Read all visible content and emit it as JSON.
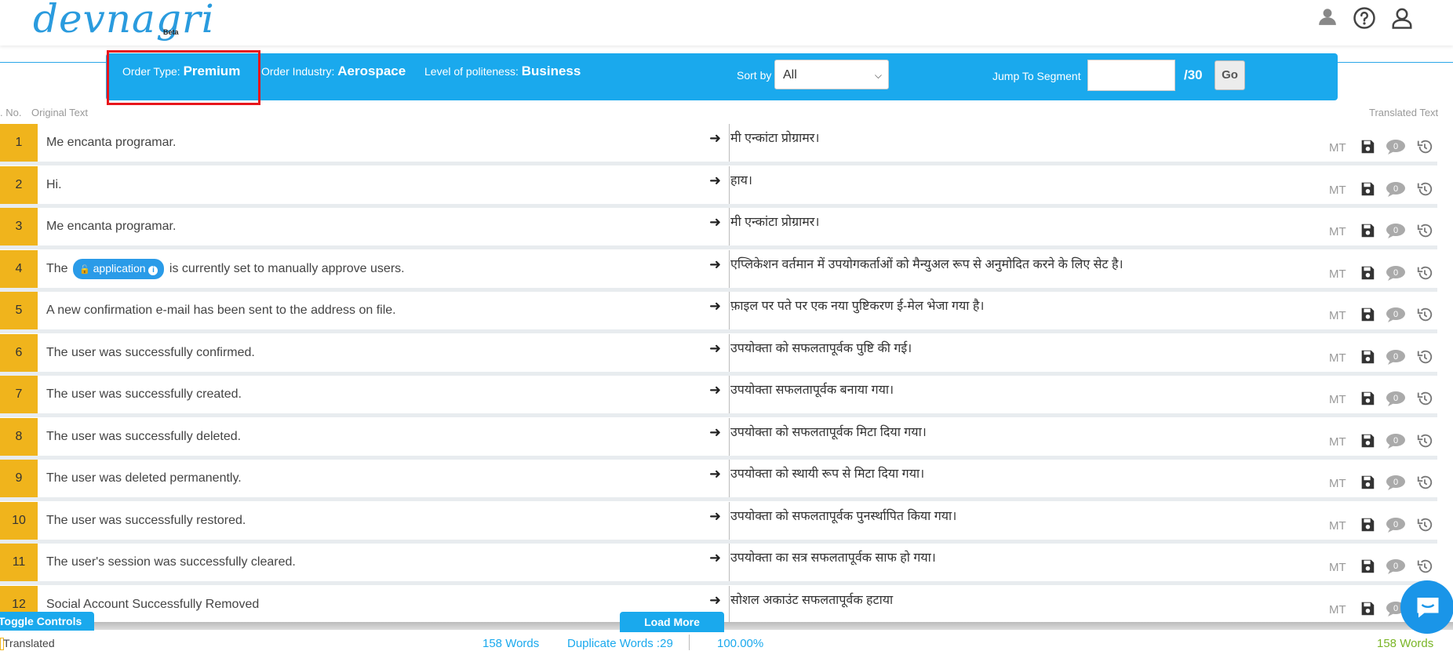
{
  "header": {
    "logo_text": "devnagri",
    "logo_badge": "Beta",
    "icons": [
      "user-icon",
      "help-icon",
      "account-icon"
    ]
  },
  "infobar": {
    "order_type_label": "Order Type:",
    "order_type_value": "Premium",
    "order_industry_label": "Order Industry:",
    "order_industry_value": "Aerospace",
    "politeness_label": "Level of politeness:",
    "politeness_value": "Business",
    "sort_label": "Sort by",
    "sort_value": "All",
    "jump_label": "Jump To Segment",
    "jump_value": "",
    "total_segments": "/30",
    "go_label": "Go"
  },
  "columns": {
    "sno": ". No.",
    "original": "Original Text",
    "translated": "Translated Text"
  },
  "rows": [
    {
      "num": "1",
      "source": "Me encanta programar.",
      "target": "मी एन्कांटा प्रोग्रामर।"
    },
    {
      "num": "2",
      "source": "Hi.",
      "target": "हाय।"
    },
    {
      "num": "3",
      "source": "Me encanta programar.",
      "target": "मी एन्कांटा प्रोग्रामर।"
    },
    {
      "num": "4",
      "source_before": "The",
      "tag": "application",
      "source_after": "is currently set to manually approve users.",
      "target": "एप्लिकेशन वर्तमान में उपयोगकर्ताओं को मैन्युअल रूप से अनुमोदित करने के लिए सेट है।"
    },
    {
      "num": "5",
      "source": "A new confirmation e-mail has been sent to the address on file.",
      "target": "फ़ाइल पर पते पर एक नया पुष्टिकरण ई-मेल भेजा गया है।"
    },
    {
      "num": "6",
      "source": "The user was successfully confirmed.",
      "target": "उपयोक्ता को सफलतापूर्वक पुष्टि की गई।"
    },
    {
      "num": "7",
      "source": "The user was successfully created.",
      "target": "उपयोक्ता सफलतापूर्वक बनाया गया।"
    },
    {
      "num": "8",
      "source": "The user was successfully deleted.",
      "target": "उपयोक्ता को सफलतापूर्वक मिटा दिया गया।"
    },
    {
      "num": "9",
      "source": "The user was deleted permanently.",
      "target": "उपयोक्ता को स्थायी रूप से मिटा दिया गया।"
    },
    {
      "num": "10",
      "source": "The user was successfully restored.",
      "target": "उपयोक्ता को सफलतापूर्वक पुनर्स्थापित किया गया।"
    },
    {
      "num": "11",
      "source": "The user's session was successfully cleared.",
      "target": "उपयोक्ता का सत्र सफलतापूर्वक साफ हो गया।"
    },
    {
      "num": "12",
      "source": "Social Account Successfully Removed",
      "target": "सोशल अकाउंट सफलतापूर्वक हटाया"
    }
  ],
  "row_actions": {
    "mt_label": "MT",
    "icons": [
      "save-icon",
      "comment-icon",
      "history-icon"
    ],
    "comment_count": "0"
  },
  "footer": {
    "toggle_label": "Toggle Controls",
    "load_more_label": "Load More",
    "status_label": "Translated",
    "words": "158 Words",
    "duplicate_words": "Duplicate Words :29",
    "percent": "100.00%",
    "words_right": "158 Words"
  },
  "colors": {
    "accent": "#1aa9ed",
    "segment_number_bg": "#f0b41c",
    "highlight_box": "#e8151b",
    "words_right": "#7ab526"
  }
}
